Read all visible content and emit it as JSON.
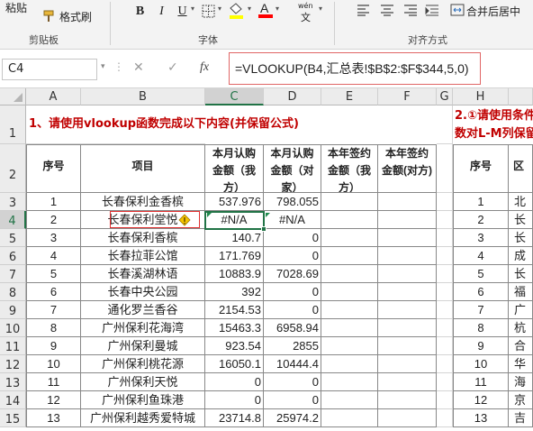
{
  "ribbon": {
    "paste_label": "粘贴",
    "format_painter_label": "格式刷",
    "clipboard_group": "剪贴板",
    "font_group": "字体",
    "align_group": "对齐方式",
    "merge_label": "合并后居中",
    "bold": "B",
    "italic": "I",
    "underline": "U",
    "wen_label": "wén",
    "font_color_glyph": "A",
    "fill_color": "#ffff00",
    "font_color": "#ff0000"
  },
  "formula_bar": {
    "name_box": "C4",
    "cancel_glyph": "✕",
    "enter_glyph": "✓",
    "fx_glyph": "fx",
    "formula": "=VLOOKUP(B4,汇总表!$B$2:$F$344,5,0)"
  },
  "columns": [
    "A",
    "B",
    "C",
    "D",
    "E",
    "F",
    "G",
    "H"
  ],
  "sheet": {
    "title1": "1、请使用vlookup函数完成以下内容(并保留公式)",
    "title2_line1": "2.①请使用条件",
    "title2_line2": "数对L-M列保留",
    "headers": {
      "no": "序号",
      "project": "项目",
      "c": "本月认购金额（我方）",
      "d": "本月认购金额（对家）",
      "e": "本年签约金额（我方）",
      "f": "本年签约金额(对方)",
      "h": "序号",
      "i": "区"
    },
    "rows": [
      {
        "row": "3",
        "no": "1",
        "project": "长春保利金香槟",
        "c": "537.976",
        "d": "798.055",
        "h": "1",
        "i": "北"
      },
      {
        "row": "4",
        "no": "2",
        "project": "长春保利堂悦",
        "c": "#N/A",
        "d": "#N/A",
        "h": "2",
        "i": "长"
      },
      {
        "row": "5",
        "no": "3",
        "project": "长春保利香槟",
        "c": "140.7",
        "d": "0",
        "h": "3",
        "i": "长"
      },
      {
        "row": "6",
        "no": "4",
        "project": "长春拉菲公馆",
        "c": "171.769",
        "d": "0",
        "h": "4",
        "i": "成"
      },
      {
        "row": "7",
        "no": "5",
        "project": "长春溪湖林语",
        "c": "10883.9",
        "d": "7028.69",
        "h": "5",
        "i": "长"
      },
      {
        "row": "8",
        "no": "6",
        "project": "长春中央公园",
        "c": "392",
        "d": "0",
        "h": "6",
        "i": "福"
      },
      {
        "row": "9",
        "no": "7",
        "project": "通化罗兰香谷",
        "c": "2154.53",
        "d": "0",
        "h": "7",
        "i": "广"
      },
      {
        "row": "10",
        "no": "8",
        "project": "广州保利花海湾",
        "c": "15463.3",
        "d": "6958.94",
        "h": "8",
        "i": "杭"
      },
      {
        "row": "11",
        "no": "9",
        "project": "广州保利曼城",
        "c": "923.54",
        "d": "2855",
        "h": "9",
        "i": "合"
      },
      {
        "row": "12",
        "no": "10",
        "project": "广州保利桃花源",
        "c": "16050.1",
        "d": "10444.4",
        "h": "10",
        "i": "华"
      },
      {
        "row": "13",
        "no": "11",
        "project": "广州保利天悦",
        "c": "0",
        "d": "0",
        "h": "11",
        "i": "海"
      },
      {
        "row": "14",
        "no": "12",
        "project": "广州保利鱼珠港",
        "c": "0",
        "d": "0",
        "h": "12",
        "i": "京"
      },
      {
        "row": "15",
        "no": "13",
        "project": "广州保利越秀爱特城",
        "c": "23714.8",
        "d": "25974.2",
        "h": "13",
        "i": "吉"
      }
    ],
    "row_headers": [
      "1",
      "2"
    ]
  }
}
